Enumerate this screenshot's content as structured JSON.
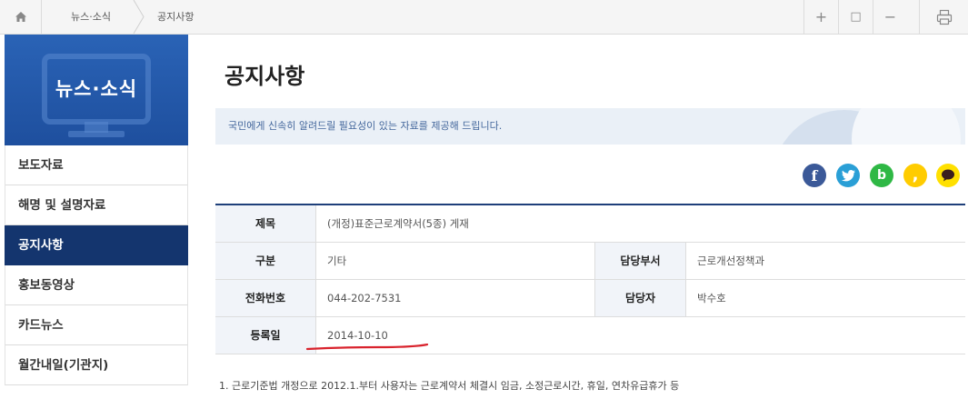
{
  "breadcrumb": [
    "뉴스·소식",
    "공지사항"
  ],
  "toolbar": {
    "zoom_in": "+",
    "reset": "□",
    "zoom_out": "−"
  },
  "sidebar": {
    "title": "뉴스·소식",
    "items": [
      {
        "label": "보도자료",
        "active": false
      },
      {
        "label": "해명 및 설명자료",
        "active": false
      },
      {
        "label": "공지사항",
        "active": true
      },
      {
        "label": "홍보동영상",
        "active": false
      },
      {
        "label": "카드뉴스",
        "active": false
      },
      {
        "label": "월간내일(기관지)",
        "active": false
      }
    ]
  },
  "main": {
    "title": "공지사항",
    "banner_text": "국민에게 신속히 알려드릴 필요성이 있는 자료를 제공해 드립니다."
  },
  "social": [
    {
      "name": "facebook-icon",
      "glyph": "f",
      "color": "#3b5998"
    },
    {
      "name": "twitter-icon",
      "glyph": "t",
      "color": "#2a9fd6"
    },
    {
      "name": "band-icon",
      "glyph": "b",
      "color": "#2fb845"
    },
    {
      "name": "kakaostory-icon",
      "glyph": ",",
      "color": "#ffcc00"
    },
    {
      "name": "kakaotalk-icon",
      "glyph": "●",
      "color": "#ffe000"
    }
  ],
  "post": {
    "title_label": "제목",
    "title_value": "(개정)표준근로계약서(5종) 게재",
    "category_label": "구분",
    "category_value": "기타",
    "dept_label": "담당부서",
    "dept_value": "근로개선정책과",
    "phone_label": "전화번호",
    "phone_value": "044-202-7531",
    "manager_label": "담당자",
    "manager_value": "박수호",
    "date_label": "등록일",
    "date_value": "2014-10-10"
  },
  "body": "1. 근로기준법 개정으로 2012.1.부터 사용자는 근로계약서 체결시 임금, 소정근로시간, 휴일, 연차유급휴가 등",
  "colors": {
    "sidebar_header": "#2a63b6",
    "active_menu": "#14356e",
    "banner_bg": "#eaf0f7",
    "table_top_border": "#1e3f7a",
    "annotation_underline": "#d9232d"
  }
}
